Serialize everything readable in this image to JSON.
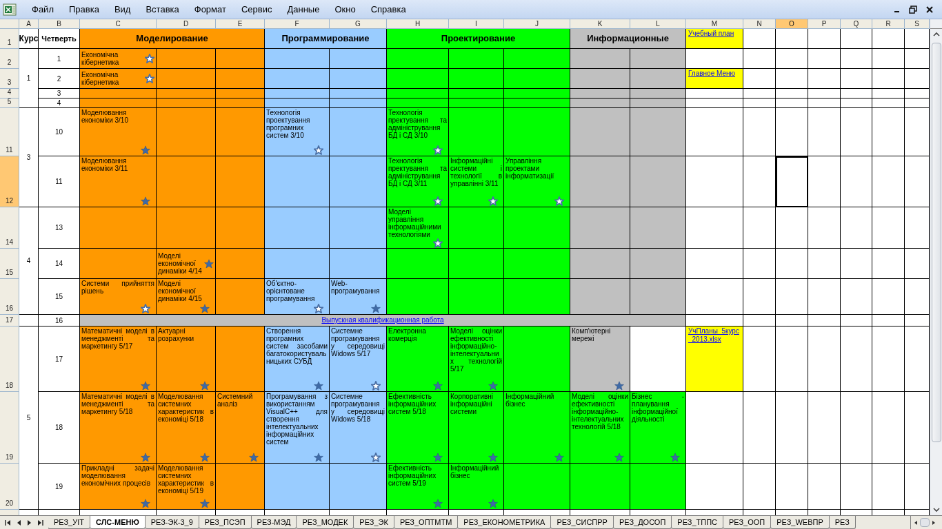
{
  "menu": [
    "Файл",
    "Правка",
    "Вид",
    "Вставка",
    "Формат",
    "Сервис",
    "Данные",
    "Окно",
    "Справка"
  ],
  "columns": [
    {
      "label": "A",
      "selected": false
    },
    {
      "label": "B",
      "selected": false
    },
    {
      "label": "C",
      "selected": false
    },
    {
      "label": "D",
      "selected": false
    },
    {
      "label": "E",
      "selected": false
    },
    {
      "label": "F",
      "selected": false
    },
    {
      "label": "G",
      "selected": false
    },
    {
      "label": "H",
      "selected": false
    },
    {
      "label": "I",
      "selected": false
    },
    {
      "label": "J",
      "selected": false
    },
    {
      "label": "K",
      "selected": false
    },
    {
      "label": "L",
      "selected": false
    },
    {
      "label": "M",
      "selected": false
    },
    {
      "label": "N",
      "selected": false
    },
    {
      "label": "O",
      "selected": true
    },
    {
      "label": "P",
      "selected": false
    },
    {
      "label": "Q",
      "selected": false
    },
    {
      "label": "R",
      "selected": false
    },
    {
      "label": "S",
      "selected": false
    }
  ],
  "header": {
    "label": "1",
    "selected": false,
    "course": "Курс",
    "quarter": "Четверть",
    "areas": [
      {
        "title": "Моделирование",
        "color": "#ff9900"
      },
      {
        "title": "Программирование",
        "color": "#99ccff"
      },
      {
        "title": "Проектирование",
        "color": "#00ff00"
      },
      {
        "title": "Информационные",
        "color": "#c0c0c0"
      }
    ],
    "link": {
      "text": "Учебный план",
      "color": "#ffff00"
    }
  },
  "courses": [
    {
      "course": "1",
      "rows": [
        {
          "label": "2",
          "selected": false,
          "quarter": "1",
          "cells": [
            {
              "color": "#ff9900",
              "text": "Економічна кібернетика",
              "kind": "hollow"
            },
            {
              "color": "#ff9900"
            },
            {
              "color": "#ff9900"
            },
            {
              "color": "#99ccff"
            },
            {
              "color": "#99ccff"
            },
            {
              "color": "#00ff00"
            },
            {
              "color": "#00ff00"
            },
            {
              "color": "#00ff00"
            },
            {
              "color": "#c0c0c0"
            },
            {
              "color": "#c0c0c0"
            }
          ]
        },
        {
          "label": "3",
          "selected": false,
          "quarter": "2",
          "cells": [
            {
              "color": "#ff9900",
              "text": "Економічна кібернетика",
              "kind": "hollow"
            },
            {
              "color": "#ff9900"
            },
            {
              "color": "#ff9900"
            },
            {
              "color": "#99ccff"
            },
            {
              "color": "#99ccff"
            },
            {
              "color": "#00ff00"
            },
            {
              "color": "#00ff00"
            },
            {
              "color": "#00ff00"
            },
            {
              "color": "#c0c0c0"
            },
            {
              "color": "#c0c0c0"
            }
          ],
          "link": {
            "text": "Главное Меню",
            "color": "#ffff00"
          }
        },
        {
          "label": "4",
          "selected": false,
          "quarter": "3",
          "cells": [
            {
              "color": "#ff9900"
            },
            {
              "color": "#ff9900"
            },
            {
              "color": "#ff9900"
            },
            {
              "color": "#99ccff"
            },
            {
              "color": "#99ccff"
            },
            {
              "color": "#00ff00"
            },
            {
              "color": "#00ff00"
            },
            {
              "color": "#00ff00"
            },
            {
              "color": "#c0c0c0"
            },
            {
              "color": "#c0c0c0"
            }
          ]
        },
        {
          "label": "5",
          "selected": false,
          "quarter": "4",
          "cells": [
            {
              "color": "#ff9900"
            },
            {
              "color": "#ff9900"
            },
            {
              "color": "#ff9900"
            },
            {
              "color": "#99ccff"
            },
            {
              "color": "#99ccff"
            },
            {
              "color": "#00ff00"
            },
            {
              "color": "#00ff00"
            },
            {
              "color": "#00ff00"
            },
            {
              "color": "#c0c0c0"
            },
            {
              "color": "#c0c0c0"
            }
          ]
        }
      ]
    },
    {
      "course": "3",
      "rows": [
        {
          "label": "11",
          "selected": false,
          "quarter": "10",
          "cells": [
            {
              "color": "#ff9900",
              "text": "Моделювання економіки 3/10",
              "kind": "filled"
            },
            {
              "color": "#ff9900"
            },
            {
              "color": "#ff9900"
            },
            {
              "color": "#99ccff",
              "text": "Технологія проектування програмних систем 3/10",
              "kind": "hollow"
            },
            {
              "color": "#99ccff"
            },
            {
              "color": "#00ff00",
              "text": "Технологія пректування та адміністрування БД і СД 3/10",
              "kind": "hollow"
            },
            {
              "color": "#00ff00"
            },
            {
              "color": "#00ff00"
            },
            {
              "color": "#c0c0c0"
            },
            {
              "color": "#c0c0c0"
            }
          ]
        },
        {
          "label": "12",
          "selected": true,
          "quarter": "11",
          "cells": [
            {
              "color": "#ff9900",
              "text": "Моделювання економіки 3/11",
              "kind": "filled"
            },
            {
              "color": "#ff9900"
            },
            {
              "color": "#ff9900"
            },
            {
              "color": "#99ccff"
            },
            {
              "color": "#99ccff"
            },
            {
              "color": "#00ff00",
              "text": "Технологія пректування та адміністрування БД і СД 3/11",
              "kind": "hollow"
            },
            {
              "color": "#00ff00",
              "text": "Інформаційні системи і технології в управлінні 3/11",
              "kind": "hollow"
            },
            {
              "color": "#00ff00",
              "text": "Управління проектами інформатизації",
              "kind": "hollow"
            },
            {
              "color": "#c0c0c0"
            },
            {
              "color": "#c0c0c0"
            }
          ]
        }
      ]
    },
    {
      "course": "4",
      "rows": [
        {
          "label": "14",
          "selected": false,
          "quarter": "13",
          "cells": [
            {
              "color": "#ff9900"
            },
            {
              "color": "#ff9900"
            },
            {
              "color": "#ff9900"
            },
            {
              "color": "#99ccff"
            },
            {
              "color": "#99ccff"
            },
            {
              "color": "#00ff00",
              "text": "Моделі управління інформаційними технологіями",
              "kind": "hollow"
            },
            {
              "color": "#00ff00"
            },
            {
              "color": "#00ff00"
            },
            {
              "color": "#c0c0c0"
            },
            {
              "color": "#c0c0c0"
            }
          ]
        },
        {
          "label": "15",
          "selected": false,
          "quarter": "14",
          "cells": [
            {
              "color": "#ff9900"
            },
            {
              "color": "#ff9900",
              "text": "Моделі економічної динаміки 4/14",
              "kind": "filled"
            },
            {
              "color": "#ff9900"
            },
            {
              "color": "#99ccff"
            },
            {
              "color": "#99ccff"
            },
            {
              "color": "#00ff00"
            },
            {
              "color": "#00ff00"
            },
            {
              "color": "#00ff00"
            },
            {
              "color": "#c0c0c0"
            },
            {
              "color": "#c0c0c0"
            }
          ]
        },
        {
          "label": "16",
          "selected": false,
          "quarter": "15",
          "cells": [
            {
              "color": "#ff9900",
              "text": "Системи прийняття рішень",
              "kind": "hollow"
            },
            {
              "color": "#ff9900",
              "text": "Моделі економічної динаміки 4/15",
              "kind": "filled"
            },
            {
              "color": "#ff9900"
            },
            {
              "color": "#99ccff",
              "text": "Об'єктно-орієнтоване програмування",
              "kind": "hollow"
            },
            {
              "color": "#99ccff",
              "text": "Web-програмування",
              "kind": "filled"
            },
            {
              "color": "#00ff00"
            },
            {
              "color": "#00ff00"
            },
            {
              "color": "#00ff00"
            },
            {
              "color": "#c0c0c0"
            },
            {
              "color": "#c0c0c0"
            }
          ]
        }
      ]
    },
    {
      "rows": [
        {
          "label": "17",
          "selected": false,
          "quarter": "16",
          "banner": {
            "text": "Выпускная квалификационная работа",
            "color": "#c0c0c0"
          }
        }
      ]
    },
    {
      "course": "5",
      "rows": [
        {
          "label": "18",
          "selected": false,
          "quarter": "17",
          "cells": [
            {
              "color": "#ff9900",
              "text": "Математичні моделі в менеджменті та маркетингу 5/17",
              "kind": "filled"
            },
            {
              "color": "#ff9900",
              "text": "Актуарні розрахунки",
              "kind": "filled"
            },
            {
              "color": "#ff9900"
            },
            {
              "color": "#99ccff",
              "text": "Створення програмних систем засобами багатокористувальницьких СУБД",
              "kind": "filled"
            },
            {
              "color": "#99ccff",
              "text": "Системне програмування у середовищі Widows 5/17",
              "kind": "hollow"
            },
            {
              "color": "#00ff00",
              "text": "Електронна комерція",
              "kind": "filled"
            },
            {
              "color": "#00ff00",
              "text": "Моделі оцінки ефективності інформаційно-інтелектуальних технологій 5/17",
              "kind": "filled"
            },
            {
              "color": "#00ff00"
            },
            {
              "color": "#c0c0c0",
              "text": "Комп'ютерні мережі",
              "kind": "filled"
            },
            {
              "color": "#ffffff"
            }
          ],
          "link": {
            "text": "УчПланы_5курс _2013.xlsx",
            "color": "#ffff00"
          }
        },
        {
          "label": "19",
          "selected": false,
          "quarter": "18",
          "cells": [
            {
              "color": "#ff9900",
              "text": "Математичні моделі в менеджменті та маркетингу 5/18",
              "kind": "filled"
            },
            {
              "color": "#ff9900",
              "text": "Моделювання системних характеристик в економіці 5/18",
              "kind": "filled"
            },
            {
              "color": "#ff9900",
              "text": "Системний аналіз",
              "kind": "filled"
            },
            {
              "color": "#99ccff",
              "text": "Програмування з використанням VisualC++ для створення інтелектуальних інформаційних систем",
              "kind": "filled"
            },
            {
              "color": "#99ccff",
              "text": "Системне програмування у середовищі Widows 5/18",
              "kind": "hollow"
            },
            {
              "color": "#00ff00",
              "text": "Ефективність інформаційних систем 5/18",
              "kind": "filled"
            },
            {
              "color": "#00ff00",
              "text": "Корпоративні інформаційні системи",
              "kind": "filled"
            },
            {
              "color": "#00ff00",
              "text": "Інформаційний бізнес",
              "kind": "filled"
            },
            {
              "color": "#00ff00",
              "text": "Моделі оцінки ефективності інформаційно-інтелектуальних технологій 5/18",
              "kind": "filled"
            },
            {
              "color": "#00ff00",
              "text": "Бізнес - планування інформаційної діяльності",
              "kind": "filled"
            }
          ]
        },
        {
          "label": "20",
          "selected": false,
          "quarter": "19",
          "cells": [
            {
              "color": "#ff9900",
              "text": "Прикладні задачі моделювання економічних процесів",
              "kind": "filled"
            },
            {
              "color": "#ff9900",
              "text": "Моделювання системних характеристик в економіці 5/19",
              "kind": "filled"
            },
            {
              "color": "#ff9900"
            },
            {
              "color": "#99ccff"
            },
            {
              "color": "#99ccff"
            },
            {
              "color": "#00ff00",
              "text": "Ефективність інформаційних систем 5/19",
              "kind": "filled"
            },
            {
              "color": "#00ff00",
              "text": "Інформаційний бізнес",
              "kind": "filled"
            },
            {
              "color": "#00ff00"
            },
            {
              "color": "#00ff00"
            },
            {
              "color": "#00ff00"
            }
          ]
        }
      ]
    }
  ],
  "sheet_tabs": [
    {
      "label": "РЕЗ_УІТ",
      "selected": false
    },
    {
      "label": "СЛС-МЕНЮ",
      "selected": true
    },
    {
      "label": "РЕЗ-ЭК-3_9",
      "selected": false
    },
    {
      "label": "РЕЗ_ПСЭП",
      "selected": false
    },
    {
      "label": "РЕЗ-МЭД",
      "selected": false
    },
    {
      "label": "РЕЗ_МОДЕК",
      "selected": false
    },
    {
      "label": "РЕЗ_ЭК",
      "selected": false
    },
    {
      "label": "РЕЗ_ОПТМТМ",
      "selected": false
    },
    {
      "label": "РЕЗ_ЕКОНОМЕТРИКА",
      "selected": false
    },
    {
      "label": "РЕЗ_СИСПРР",
      "selected": false
    },
    {
      "label": "РЕЗ_ДОСОП",
      "selected": false
    },
    {
      "label": "РЕЗ_ТППС",
      "selected": false
    },
    {
      "label": "РЕЗ_ООП",
      "selected": false
    },
    {
      "label": "РЕЗ_WEBПР",
      "selected": false
    },
    {
      "label": "РЕЗ",
      "selected": false
    }
  ]
}
